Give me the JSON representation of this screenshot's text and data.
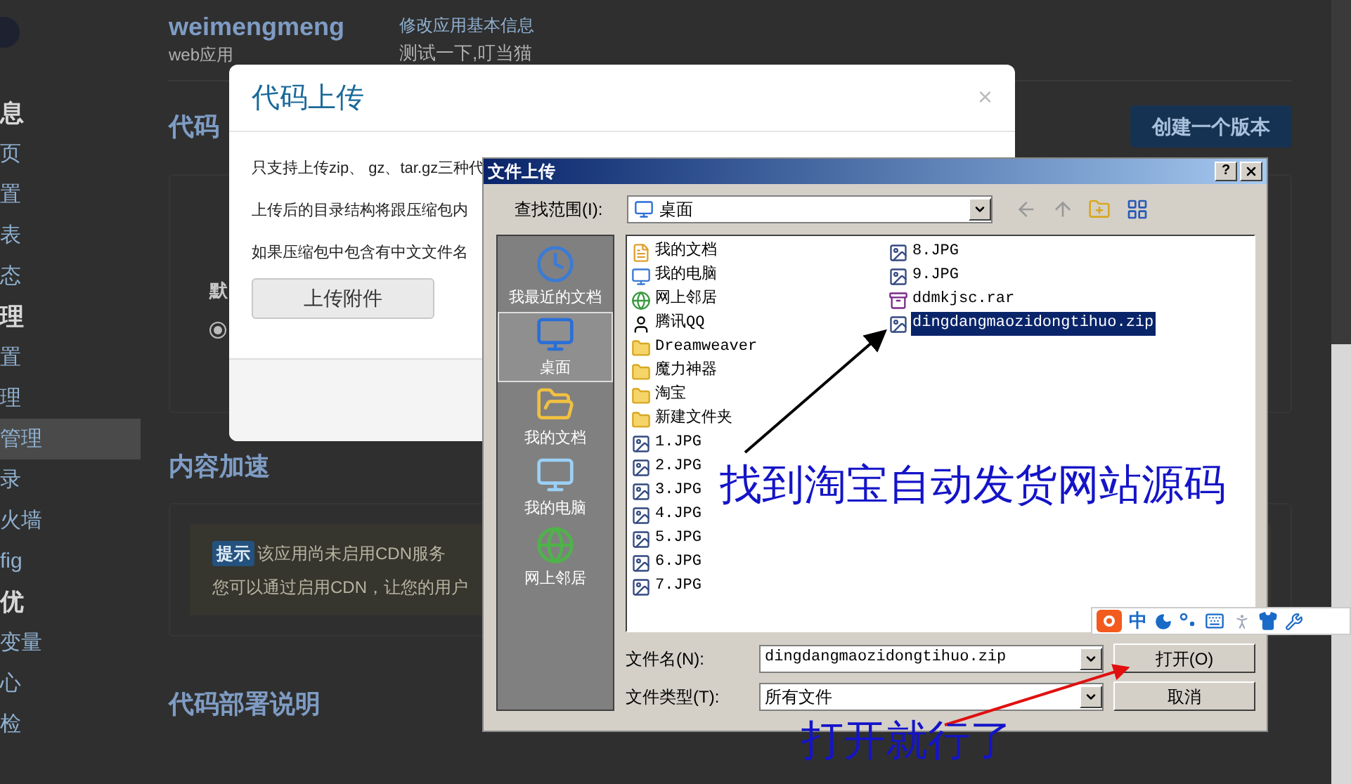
{
  "header": {
    "app_name": "weimengmeng",
    "app_type": "web应用",
    "edit_link": "修改应用基本信息",
    "description": "测试一下,叮当猫"
  },
  "sidebar": {
    "items": [
      {
        "label": "息",
        "kind": "heading",
        "selected": false
      },
      {
        "label": "页",
        "kind": "item",
        "selected": false
      },
      {
        "label": "置",
        "kind": "item",
        "selected": false
      },
      {
        "label": "表",
        "kind": "item",
        "selected": false
      },
      {
        "label": "态",
        "kind": "item",
        "selected": false
      },
      {
        "label": "理",
        "kind": "heading",
        "selected": false
      },
      {
        "label": "置",
        "kind": "item",
        "selected": false
      },
      {
        "label": "理",
        "kind": "item",
        "selected": false
      },
      {
        "label": "管理",
        "kind": "item",
        "selected": true
      },
      {
        "label": "录",
        "kind": "item",
        "selected": false
      },
      {
        "label": "火墙",
        "kind": "item",
        "selected": false
      },
      {
        "label": "fig",
        "kind": "item",
        "selected": false
      },
      {
        "label": "优",
        "kind": "heading",
        "selected": false
      },
      {
        "label": "变量",
        "kind": "item",
        "selected": false
      },
      {
        "label": "心",
        "kind": "item",
        "selected": false
      },
      {
        "label": "检",
        "kind": "item",
        "selected": false
      }
    ]
  },
  "code_section": {
    "title": "代码",
    "create_button": "创建一个版本",
    "card_label": "默",
    "radio": {
      "checked": true
    }
  },
  "cdn_section": {
    "title": "内容加速",
    "badge": "提示",
    "notice": "该应用尚未启用CDN服务",
    "detail": "您可以通过启用CDN，让您的用户"
  },
  "deploy_section": {
    "title": "代码部署说明"
  },
  "modal": {
    "title": "代码上传",
    "close": "×",
    "lines": [
      "只支持上传zip、 gz、tar.gz三种代",
      "上传后的目录结构将跟压缩包内",
      "如果压缩包中包含有中文文件名"
    ],
    "upload_button": "上传附件"
  },
  "file_dialog": {
    "title": "文件上传",
    "help_button": "?",
    "look_in_label": "查找范围(I):",
    "look_in_value": "桌面",
    "places": [
      {
        "label": "我最近的文档",
        "kind": "recent",
        "selected": false
      },
      {
        "label": "桌面",
        "kind": "desktop",
        "selected": true
      },
      {
        "label": "我的文档",
        "kind": "documents",
        "selected": false
      },
      {
        "label": "我的电脑",
        "kind": "computer",
        "selected": false
      },
      {
        "label": "网上邻居",
        "kind": "network",
        "selected": false
      }
    ],
    "files": [
      {
        "name": "我的文档",
        "kind": "documents",
        "selected": false
      },
      {
        "name": "我的电脑",
        "kind": "computer",
        "selected": false
      },
      {
        "name": "网上邻居",
        "kind": "network",
        "selected": false
      },
      {
        "name": "腾讯QQ",
        "kind": "shortcut",
        "selected": false
      },
      {
        "name": "Dreamweaver",
        "kind": "folder",
        "selected": false
      },
      {
        "name": "魔力神器",
        "kind": "folder",
        "selected": false
      },
      {
        "name": "淘宝",
        "kind": "folder",
        "selected": false
      },
      {
        "name": "新建文件夹",
        "kind": "folder",
        "selected": false
      },
      {
        "name": "1.JPG",
        "kind": "image",
        "selected": false
      },
      {
        "name": "2.JPG",
        "kind": "image",
        "selected": false
      },
      {
        "name": "3.JPG",
        "kind": "image",
        "selected": false
      },
      {
        "name": "4.JPG",
        "kind": "image",
        "selected": false
      },
      {
        "name": "5.JPG",
        "kind": "image",
        "selected": false
      },
      {
        "name": "6.JPG",
        "kind": "image",
        "selected": false
      },
      {
        "name": "7.JPG",
        "kind": "image",
        "selected": false
      },
      {
        "name": "8.JPG",
        "kind": "image",
        "selected": false
      },
      {
        "name": "9.JPG",
        "kind": "image",
        "selected": false
      },
      {
        "name": "ddmkjsc.rar",
        "kind": "archive",
        "selected": false
      },
      {
        "name": "dingdangmaozidongtihuo.zip",
        "kind": "image",
        "selected": true
      }
    ],
    "filename_label": "文件名(N):",
    "filename_value": "dingdangmaozidongtihuo.zip",
    "filetype_label": "文件类型(T):",
    "filetype_value": "所有文件",
    "open_button": "打开(O)",
    "cancel_button": "取消"
  },
  "annotations": [
    {
      "text": "找到淘宝自动发货网站源码",
      "kind": "top"
    },
    {
      "text": "打开就行了",
      "kind": "bottom"
    }
  ],
  "ime_toolbar": {
    "mode": "中"
  }
}
